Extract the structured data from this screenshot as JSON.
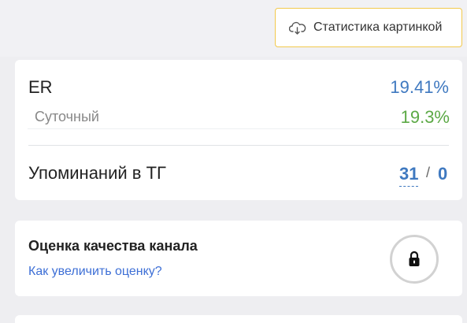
{
  "header": {
    "stats_button_label": "Статистика картинкой",
    "stats_button_icon": "cloud-download-icon",
    "accent_border": "#f2c94c"
  },
  "er_card": {
    "er_label": "ER",
    "er_value": "19.41%",
    "daily_label": "Суточный",
    "daily_value": "19.3%",
    "mentions_label": "Упоминаний в ТГ",
    "mentions_value_a": "31",
    "mentions_separator": "/",
    "mentions_value_b": "0"
  },
  "quality_card": {
    "title": "Оценка качества канала",
    "link_label": "Как увеличить оценку?",
    "lock_icon": "lock-icon"
  },
  "colors": {
    "blue_value": "#3f79c0",
    "green_value": "#5ca946",
    "link": "#3d6fd6"
  }
}
